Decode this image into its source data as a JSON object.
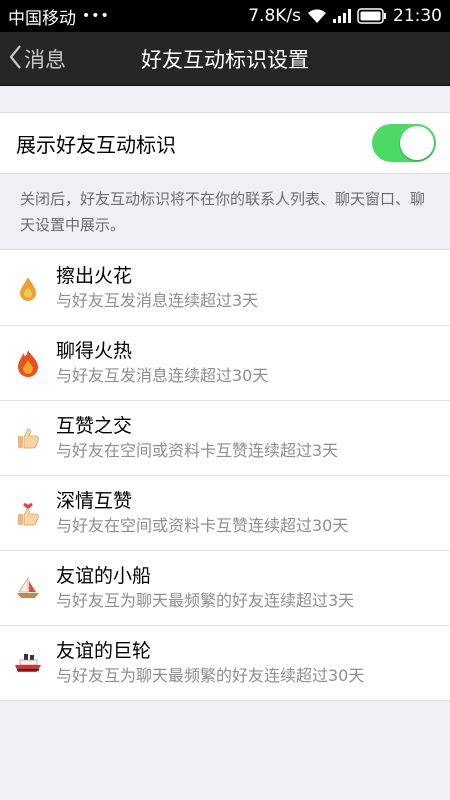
{
  "status": {
    "carrier": "中国移动",
    "dots": "•••",
    "speed": "7.8K/s",
    "time": "21:30"
  },
  "nav": {
    "back_label": "消息",
    "title": "好友互动标识设置"
  },
  "toggle": {
    "label": "展示好友互动标识",
    "on": true,
    "color": "#4cd964"
  },
  "description": "关闭后，好友互动标识将不在你的联系人列表、聊天窗口、聊天设置中展示。",
  "items": [
    {
      "name": "擦出火花",
      "desc": "与好友互发消息连续超过3天",
      "icon": "spark-flame-icon"
    },
    {
      "name": "聊得火热",
      "desc": "与好友互发消息连续超过30天",
      "icon": "big-fire-icon"
    },
    {
      "name": "互赞之交",
      "desc": "与好友在空间或资料卡互赞连续超过3天",
      "icon": "thumbs-up-icon"
    },
    {
      "name": "深情互赞",
      "desc": "与好友在空间或资料卡互赞连续超过30天",
      "icon": "thumbs-up-heart-icon"
    },
    {
      "name": "友谊的小船",
      "desc": "与好友互为聊天最频繁的好友连续超过3天",
      "icon": "sailboat-icon"
    },
    {
      "name": "友谊的巨轮",
      "desc": "与好友互为聊天最频繁的好友连续超过30天",
      "icon": "ship-icon"
    }
  ]
}
